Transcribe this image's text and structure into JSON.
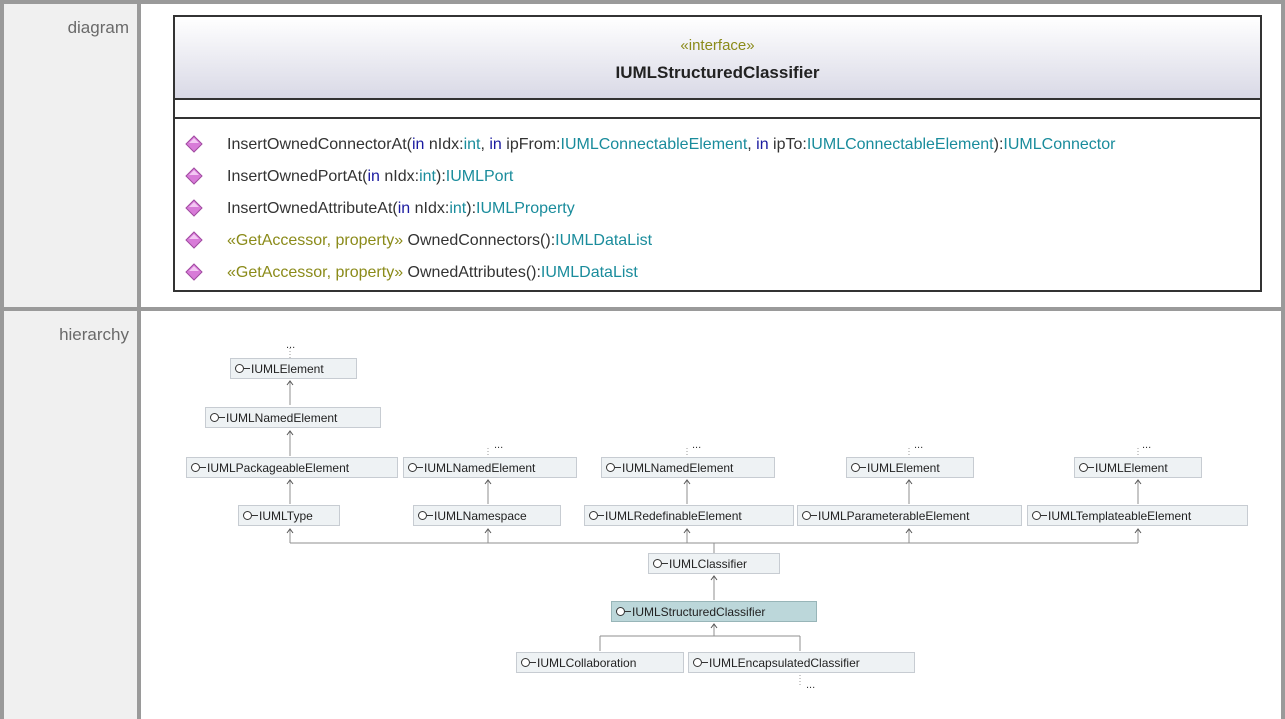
{
  "rows": {
    "diagram_label": "diagram",
    "hierarchy_label": "hierarchy"
  },
  "uml": {
    "stereotype": "«interface»",
    "class_name": "IUMLStructuredClassifier",
    "operations": [
      {
        "parts": [
          {
            "t": "InsertOwnedConnectorAt(",
            "c": "n"
          },
          {
            "t": "in",
            "c": "kw"
          },
          {
            "t": " nIdx:",
            "c": "n"
          },
          {
            "t": "int",
            "c": "ty"
          },
          {
            "t": ", ",
            "c": "n"
          },
          {
            "t": "in",
            "c": "kw"
          },
          {
            "t": " ipFrom:",
            "c": "n"
          },
          {
            "t": "IUMLConnectableElement",
            "c": "ty"
          },
          {
            "t": ", ",
            "c": "n"
          },
          {
            "t": "in",
            "c": "kw"
          },
          {
            "t": " ipTo:",
            "c": "n"
          },
          {
            "t": "IUMLConnectableElement",
            "c": "ty"
          },
          {
            "t": "):",
            "c": "n"
          },
          {
            "t": "IUMLConnector",
            "c": "ty"
          }
        ]
      },
      {
        "parts": [
          {
            "t": "InsertOwnedPortAt(",
            "c": "n"
          },
          {
            "t": "in",
            "c": "kw"
          },
          {
            "t": " nIdx:",
            "c": "n"
          },
          {
            "t": "int",
            "c": "ty"
          },
          {
            "t": "):",
            "c": "n"
          },
          {
            "t": "IUMLPort",
            "c": "ty"
          }
        ]
      },
      {
        "parts": [
          {
            "t": "InsertOwnedAttributeAt(",
            "c": "n"
          },
          {
            "t": "in",
            "c": "kw"
          },
          {
            "t": " nIdx:",
            "c": "n"
          },
          {
            "t": "int",
            "c": "ty"
          },
          {
            "t": "):",
            "c": "n"
          },
          {
            "t": "IUMLProperty",
            "c": "ty"
          }
        ]
      },
      {
        "parts": [
          {
            "t": "«GetAccessor, property»",
            "c": "st"
          },
          {
            "t": " OwnedConnectors():",
            "c": "n"
          },
          {
            "t": "IUMLDataList",
            "c": "ty"
          }
        ]
      },
      {
        "parts": [
          {
            "t": "«GetAccessor, property»",
            "c": "st"
          },
          {
            "t": " OwnedAttributes():",
            "c": "n"
          },
          {
            "t": "IUMLDataList",
            "c": "ty"
          }
        ]
      }
    ]
  },
  "hierarchy": {
    "ellipsis": "...",
    "nodes": {
      "n_el1": "IUMLElement",
      "n_named1": "IUMLNamedElement",
      "n_pack": "IUMLPackageableElement",
      "n_named2": "IUMLNamedElement",
      "n_named3": "IUMLNamedElement",
      "n_el2": "IUMLElement",
      "n_el3": "IUMLElement",
      "n_type": "IUMLType",
      "n_ns": "IUMLNamespace",
      "n_redef": "IUMLRedefinableElement",
      "n_param": "IUMLParameterableElement",
      "n_templ": "IUMLTemplateableElement",
      "n_classifier": "IUMLClassifier",
      "n_struct": "IUMLStructuredClassifier",
      "n_collab": "IUMLCollaboration",
      "n_encap": "IUMLEncapsulatedClassifier"
    }
  },
  "colors": {
    "frame": "#9a9a9a",
    "label_bg": "#f0f0f0",
    "keyword": "#1a1aa0",
    "type": "#1a8c9c",
    "stereotype": "#8b8b1a",
    "operation_icon": "#d87bd8",
    "selected_node": "#bcd7da"
  }
}
